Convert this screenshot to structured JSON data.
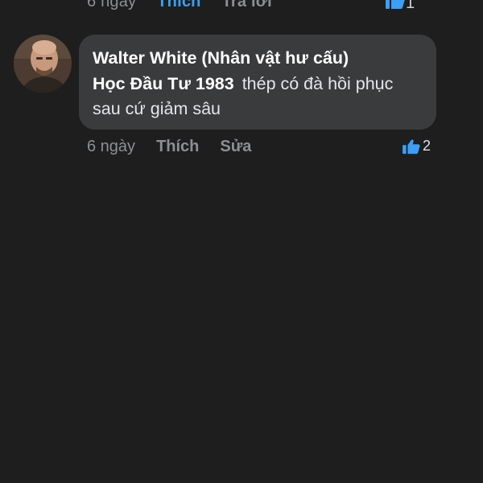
{
  "previous_comment": {
    "time": "6 ngày",
    "like_label": "Thích",
    "reply_label": "Trả lời",
    "reaction_count": "1"
  },
  "comment": {
    "author": "Walter White (Nhân vật hư cấu)",
    "mention": "Học Đầu Tư 1983",
    "text": "thép có đà hồi phục sau cứ giảm sâu",
    "time": "6 ngày",
    "like_label": "Thích",
    "edit_label": "Sửa",
    "reaction_count": "2",
    "avatar_icon": "user-avatar"
  },
  "colors": {
    "background": "#1e1e1e",
    "bubble": "#3a3b3c",
    "accent_blue": "#3b9ff7",
    "muted_text": "#8c8f94"
  }
}
